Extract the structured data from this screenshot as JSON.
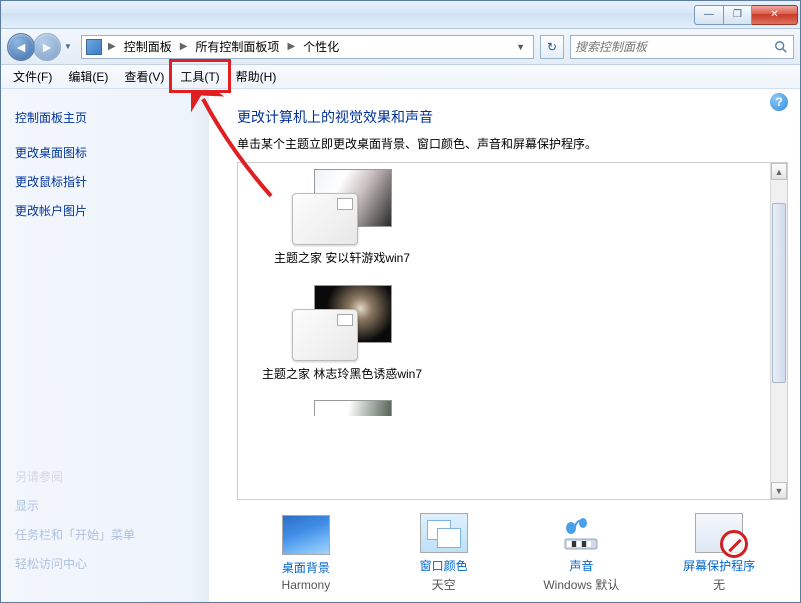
{
  "titlebar": {
    "minimize": "—",
    "maximize": "❐",
    "close": "✕"
  },
  "breadcrumb": {
    "items": [
      "控制面板",
      "所有控制面板项",
      "个性化"
    ]
  },
  "search": {
    "placeholder": "搜索控制面板"
  },
  "menubar": {
    "items": [
      {
        "label": "文件(F)"
      },
      {
        "label": "编辑(E)"
      },
      {
        "label": "查看(V)"
      },
      {
        "label": "工具(T)"
      },
      {
        "label": "帮助(H)"
      }
    ]
  },
  "sidebar": {
    "home": "控制面板主页",
    "links": [
      "更改桌面图标",
      "更改鼠标指针",
      "更改帐户图片"
    ],
    "see_also_header": "另请参阅",
    "see_also": [
      "显示",
      "任务栏和「开始」菜单",
      "轻松访问中心"
    ]
  },
  "main": {
    "heading": "更改计算机上的视觉效果和声音",
    "subtext": "单击某个主题立即更改桌面背景、窗口颜色、声音和屏幕保护程序。",
    "themes": [
      {
        "title": "主题之家 安以轩游戏win7"
      },
      {
        "title": "主题之家 林志玲黑色诱惑win7"
      }
    ],
    "settings": [
      {
        "label": "桌面背景",
        "value": "Harmony",
        "icon": "desktop-background-icon"
      },
      {
        "label": "窗口颜色",
        "value": "天空",
        "icon": "window-color-icon"
      },
      {
        "label": "声音",
        "value": "Windows 默认",
        "icon": "sound-icon"
      },
      {
        "label": "屏幕保护程序",
        "value": "无",
        "icon": "screensaver-icon"
      }
    ]
  },
  "annotation": {
    "highlight_menu_index": 3,
    "arrow_color": "#e02020"
  }
}
